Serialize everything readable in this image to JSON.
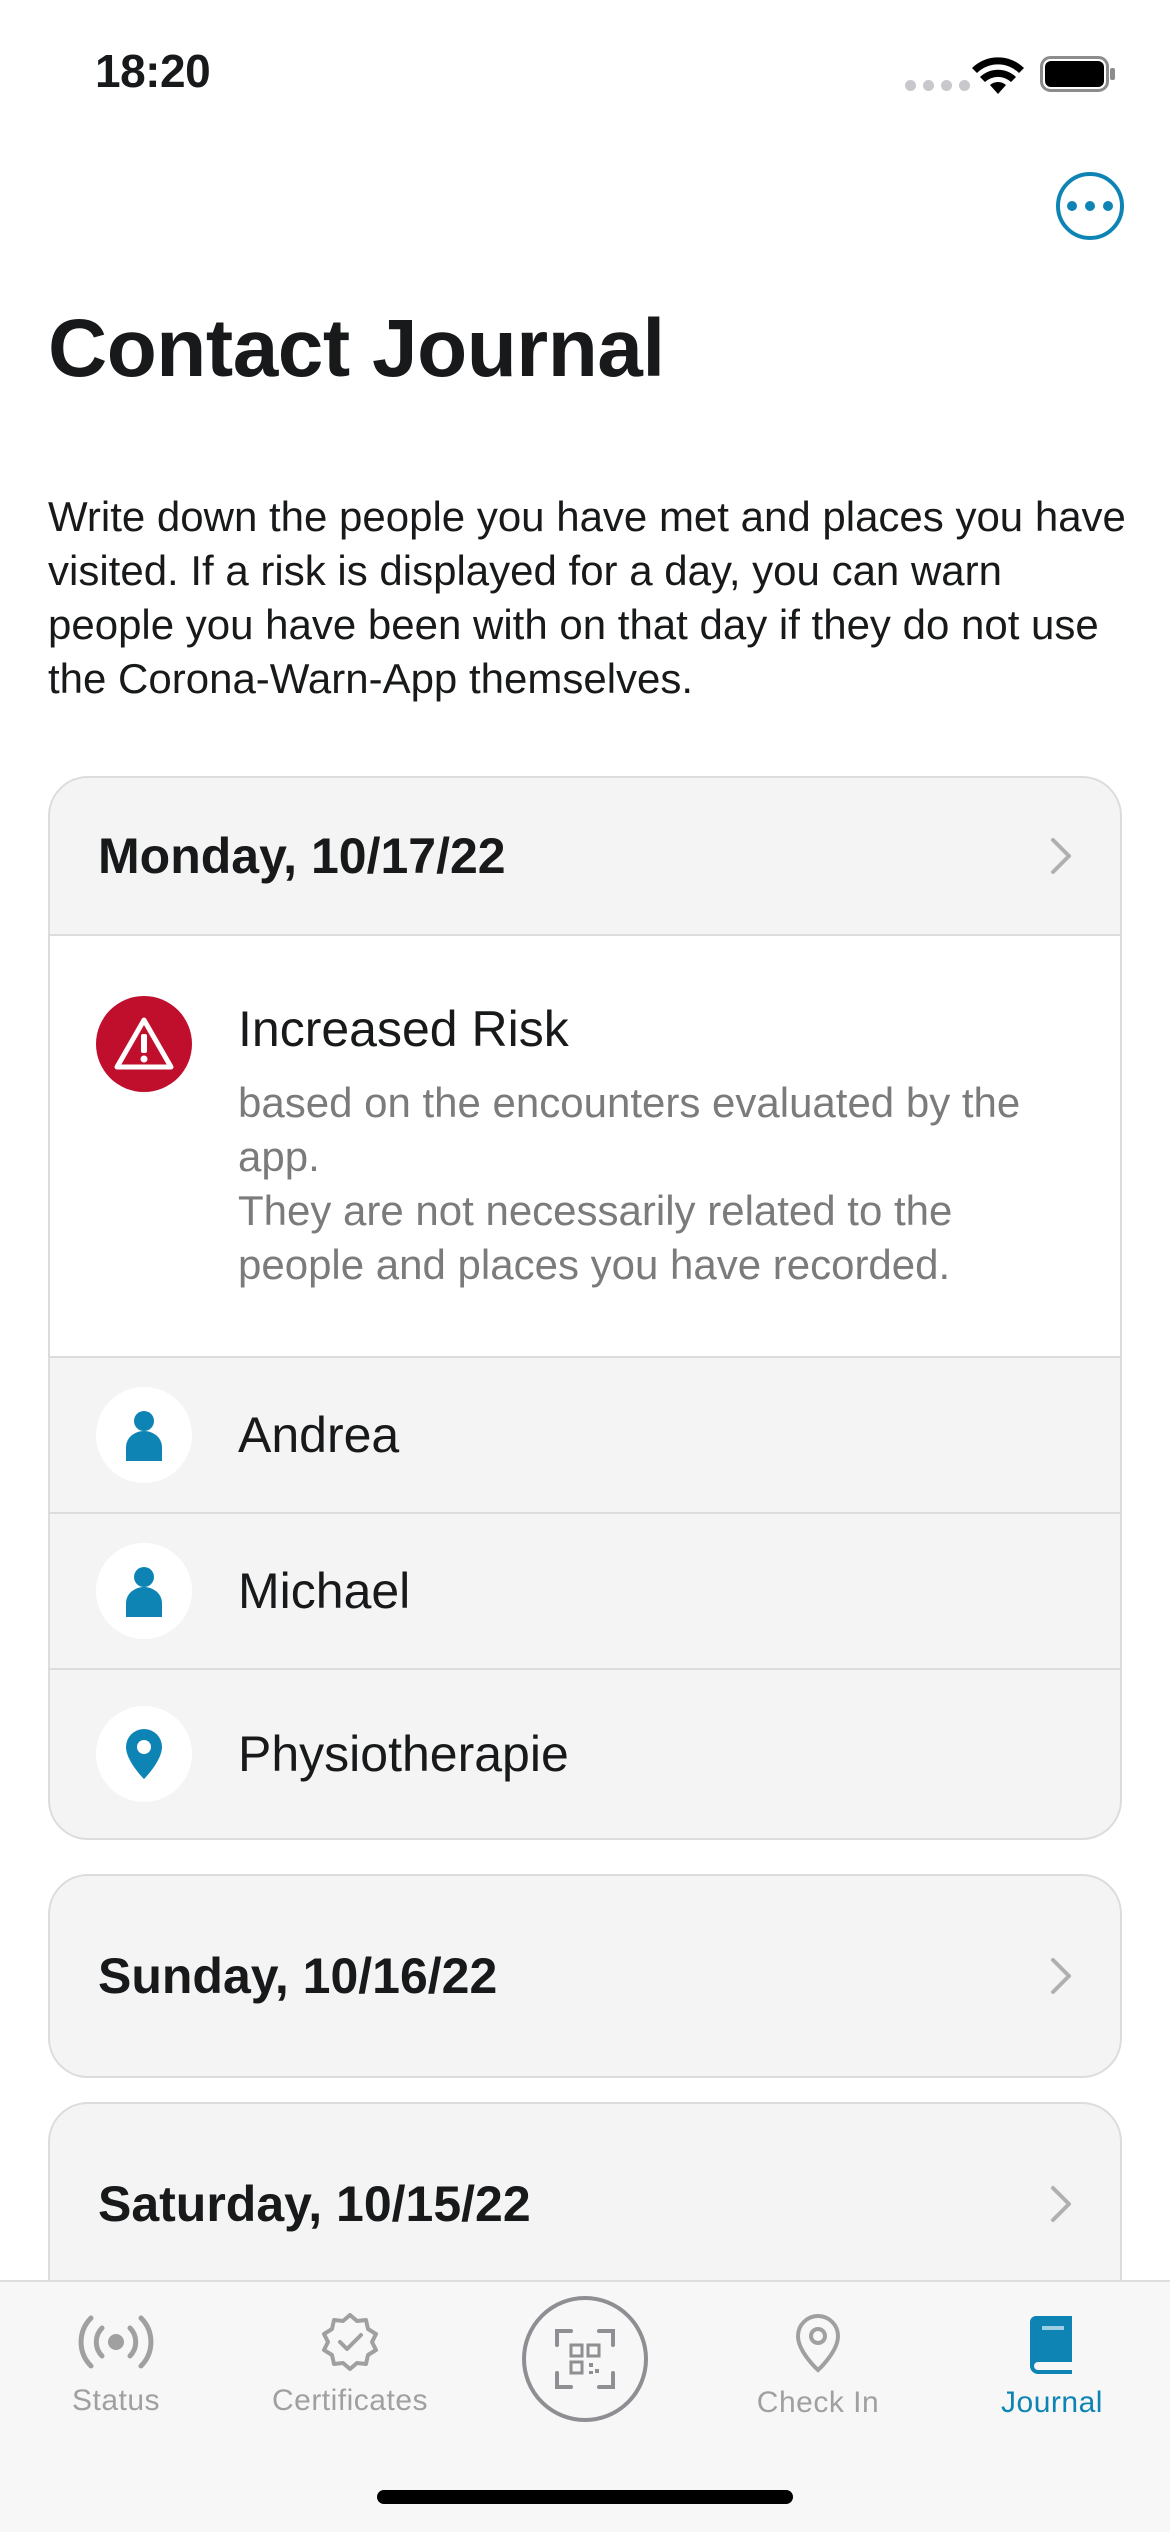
{
  "status_bar": {
    "time": "18:20"
  },
  "header": {
    "more_icon": "ellipsis-circle-icon",
    "title": "Contact Journal",
    "description": "Write down the people you have met and places you have visited. If a risk is displayed for a day, you can warn people you have been with on that day if they do not use the Corona-Warn-App themselves."
  },
  "days": [
    {
      "date": "Monday, 10/17/22",
      "risk": {
        "icon": "warning-triangle-icon",
        "title": "Increased Risk",
        "description": "based on the encounters evaluated by the app.\nThey are not necessarily related to the people and places you have recorded."
      },
      "entries": [
        {
          "label": "Andrea",
          "icon": "person-icon"
        },
        {
          "label": "Michael",
          "icon": "person-icon"
        },
        {
          "label": "Physiotherapie",
          "icon": "location-pin-icon"
        }
      ]
    },
    {
      "date": "Sunday, 10/16/22"
    },
    {
      "date": "Saturday, 10/15/22"
    }
  ],
  "tab_bar": {
    "tabs": [
      {
        "label": "Status",
        "icon": "radar-icon",
        "active": false
      },
      {
        "label": "Certificates",
        "icon": "certificate-badge-icon",
        "active": false
      },
      {
        "label": "",
        "icon": "qr-scan-icon",
        "active": false
      },
      {
        "label": "Check In",
        "icon": "location-pin-icon",
        "active": false
      },
      {
        "label": "Journal",
        "icon": "book-icon",
        "active": true
      }
    ]
  },
  "colors": {
    "accent": "#0e84b5",
    "risk_red": "#c00f2d",
    "card_bg": "#f4f4f4",
    "inactive_tab": "#a0a0a0"
  }
}
